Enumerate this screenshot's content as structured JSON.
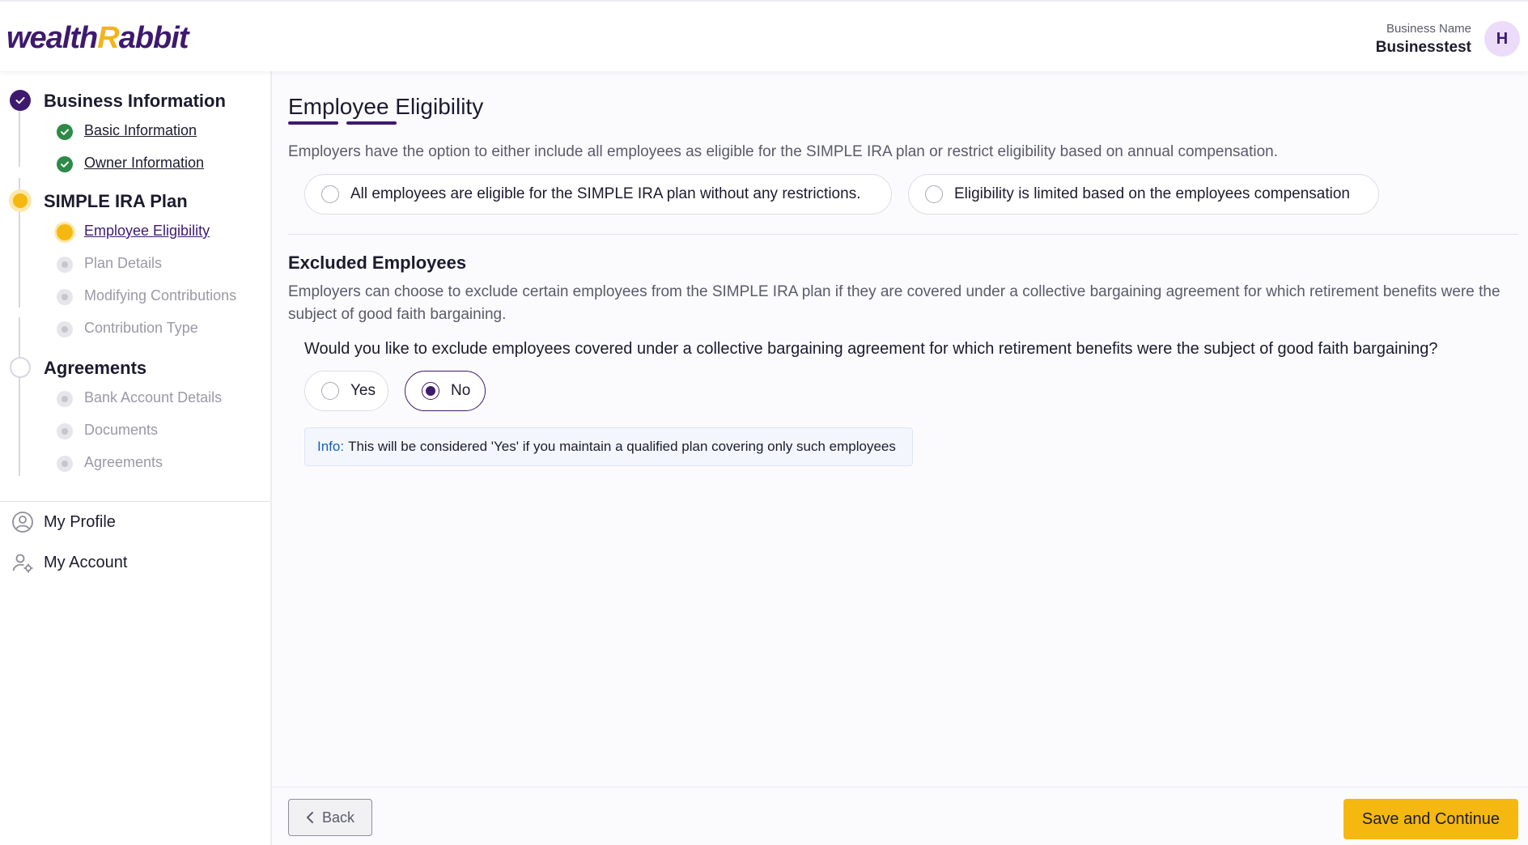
{
  "header": {
    "logo_left": "wealth",
    "logo_r": "R",
    "logo_right": "abbit",
    "business_label": "Business Name",
    "business_value": "Businesstest",
    "avatar_initial": "H"
  },
  "sidebar": {
    "sections": [
      {
        "label": "Business Information",
        "status": "complete",
        "items": [
          {
            "label": "Basic Information",
            "status": "complete"
          },
          {
            "label": "Owner Information",
            "status": "complete"
          }
        ]
      },
      {
        "label": "SIMPLE IRA Plan",
        "status": "in-progress",
        "items": [
          {
            "label": "Employee Eligibility",
            "status": "current"
          },
          {
            "label": "Plan Details",
            "status": "pending"
          },
          {
            "label": "Modifying Contributions",
            "status": "pending"
          },
          {
            "label": "Contribution Type",
            "status": "pending"
          }
        ]
      },
      {
        "label": "Agreements",
        "status": "pending",
        "items": [
          {
            "label": "Bank Account Details",
            "status": "pending"
          },
          {
            "label": "Documents",
            "status": "pending"
          },
          {
            "label": "Agreements",
            "status": "pending"
          }
        ]
      }
    ],
    "nav": [
      {
        "label": "My Profile",
        "icon": "user-circle-icon"
      },
      {
        "label": "My Account",
        "icon": "user-settings-icon"
      }
    ]
  },
  "main": {
    "title": "Employee Eligibility",
    "eligibility_description": "Employers have the option to either include all employees as eligible for the SIMPLE IRA plan or restrict eligibility based on annual compensation.",
    "eligibility_options": [
      {
        "label": "All employees are eligible for the SIMPLE IRA plan without any restrictions.",
        "selected": false
      },
      {
        "label": "Eligibility is limited based on the employees compensation",
        "selected": false
      }
    ],
    "excluded_title": "Excluded Employees",
    "excluded_description": "Employers can choose to exclude certain employees from the SIMPLE IRA plan if they are covered under a collective bargaining agreement for which retirement benefits were the subject of good faith bargaining.",
    "question": "Would you like to exclude employees covered under a collective bargaining agreement for which retirement benefits were the subject of good faith bargaining?",
    "answer_options": [
      {
        "label": "Yes",
        "selected": false
      },
      {
        "label": "No",
        "selected": true
      }
    ],
    "info_key": "Info:",
    "info_text": "This will be considered 'Yes' if you maintain a qualified plan covering only such employees"
  },
  "footer": {
    "back_label": "Back",
    "save_label": "Save and Continue"
  },
  "colors": {
    "brand_purple": "#3e1a6e",
    "accent_yellow": "#f5b810",
    "success_green": "#2d8a47",
    "info_blue": "#1b5fb5"
  }
}
